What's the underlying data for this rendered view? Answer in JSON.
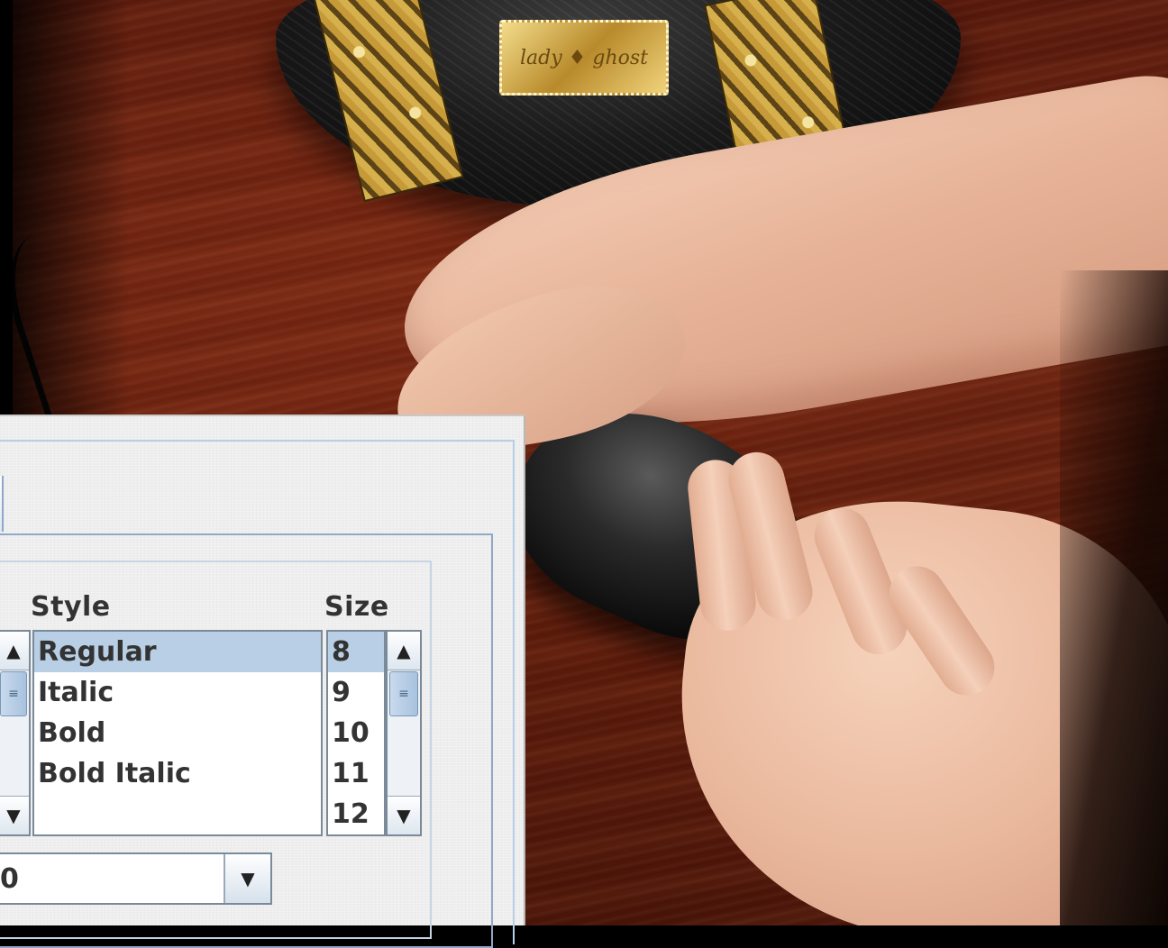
{
  "dialog": {
    "style_label": "Style",
    "size_label": "Size",
    "style_options": [
      "Regular",
      "Italic",
      "Bold",
      "Bold Italic"
    ],
    "selected_style": "Regular",
    "size_options": [
      "8",
      "9",
      "10",
      "11",
      "12"
    ],
    "selected_size": "8",
    "combo_value": "0",
    "icons": {
      "scroll_up": "triangle-up-icon",
      "scroll_down": "triangle-down-icon",
      "scroll_thumb_grip": "grip-lines-icon",
      "combo_dropdown": "chevron-down-icon"
    }
  },
  "photo": {
    "purse_plaque_text": "lady ♦ ghost"
  },
  "colors": {
    "selection": "#b8cfe5",
    "panel_border": "#8fa8c8",
    "dialog_background": "#eeeeee"
  }
}
